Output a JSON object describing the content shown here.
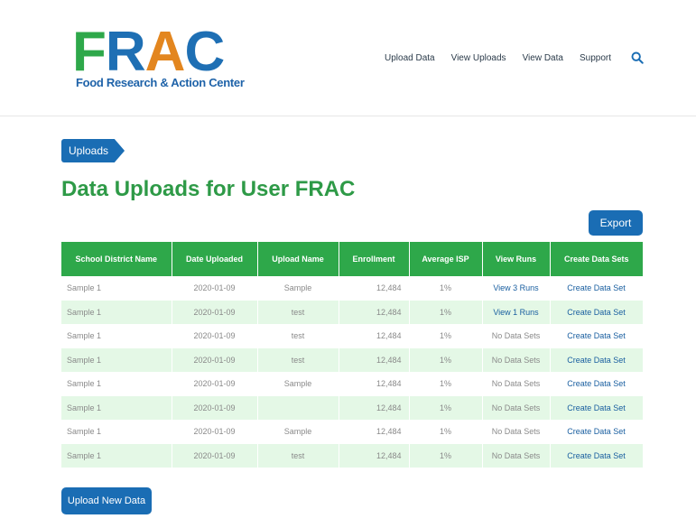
{
  "logo": {
    "letters": [
      "F",
      "R",
      "A",
      "C"
    ],
    "colors": {
      "F": "#2ea84a",
      "R": "#1e6fb4",
      "A": "#e3861f",
      "C": "#1e6fb4"
    },
    "subtitle": "Food Research & Action Center"
  },
  "nav": {
    "items": [
      "Upload Data",
      "View Uploads",
      "View Data",
      "Support"
    ],
    "search_icon": "search-icon"
  },
  "breadcrumb": "Uploads",
  "page_title": "Data Uploads for User FRAC",
  "export_label": "Export",
  "table": {
    "headers": [
      "School District Name",
      "Date Uploaded",
      "Upload Name",
      "Enrollment",
      "Average ISP",
      "View Runs",
      "Create Data Sets"
    ],
    "rows": [
      {
        "name": "Sample 1",
        "date": "2020-01-09",
        "upload_name": "Sample",
        "enrollment": "12,484",
        "isp": "1%",
        "runs": "View 3 Runs",
        "create": "Create Data Set"
      },
      {
        "name": "Sample 1",
        "date": "2020-01-09",
        "upload_name": "test",
        "enrollment": "12,484",
        "isp": "1%",
        "runs": "View 1 Runs",
        "create": "Create Data Set"
      },
      {
        "name": "Sample 1",
        "date": "2020-01-09",
        "upload_name": "test",
        "enrollment": "12,484",
        "isp": "1%",
        "runs": "No Data Sets",
        "create": "Create Data Set"
      },
      {
        "name": "Sample 1",
        "date": "2020-01-09",
        "upload_name": "test",
        "enrollment": "12,484",
        "isp": "1%",
        "runs": "No Data Sets",
        "create": "Create Data Set"
      },
      {
        "name": "Sample 1",
        "date": "2020-01-09",
        "upload_name": "Sample",
        "enrollment": "12,484",
        "isp": "1%",
        "runs": "No Data Sets",
        "create": "Create Data Set"
      },
      {
        "name": "Sample 1",
        "date": "2020-01-09",
        "upload_name": "",
        "enrollment": "12,484",
        "isp": "1%",
        "runs": "No Data Sets",
        "create": "Create Data Set"
      },
      {
        "name": "Sample 1",
        "date": "2020-01-09",
        "upload_name": "Sample",
        "enrollment": "12,484",
        "isp": "1%",
        "runs": "No Data Sets",
        "create": "Create Data Set"
      },
      {
        "name": "Sample 1",
        "date": "2020-01-09",
        "upload_name": "test",
        "enrollment": "12,484",
        "isp": "1%",
        "runs": "No Data Sets",
        "create": "Create Data Set"
      }
    ]
  },
  "upload_button_label": "Upload New Data",
  "colors": {
    "primary_blue": "#1a6db4",
    "header_green": "#2ea84a",
    "title_green": "#2e9a47",
    "row_alt": "#e4f8e6"
  }
}
